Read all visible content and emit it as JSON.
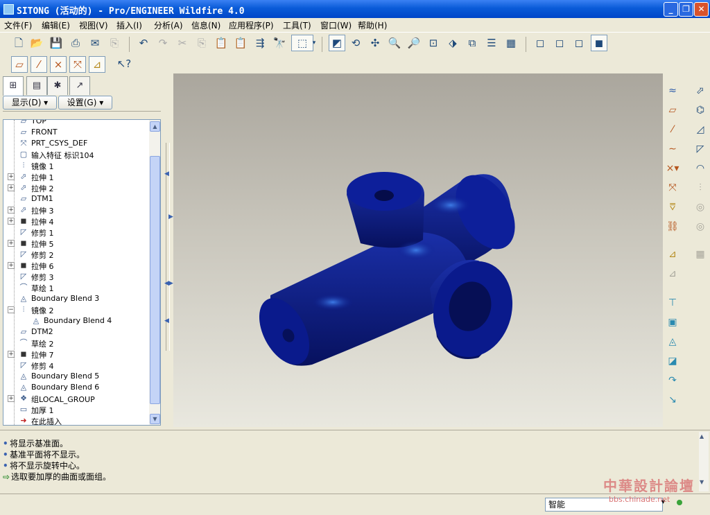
{
  "window": {
    "title": "SITONG (活动的) - Pro/ENGINEER Wildfire 4.0",
    "minimize": "_",
    "maximize": "❐",
    "close": "✕"
  },
  "menu": [
    "文件(F)",
    "编辑(E)",
    "视图(V)",
    "插入(I)",
    "分析(A)",
    "信息(N)",
    "应用程序(P)",
    "工具(T)",
    "窗口(W)",
    "帮助(H)"
  ],
  "toolbar_icons": [
    "new-icon",
    "open-icon",
    "save-icon",
    "print-icon",
    "send-icon",
    "copy-icon",
    "undo-icon",
    "redo-icon",
    "cut-icon",
    "copy-icon",
    "paste-icon",
    "paste-special-icon",
    "regenerate-icon",
    "find-icon",
    "select-box-icon",
    "repaint-icon",
    "spin-center-icon",
    "orient-icon",
    "zoom-in-icon",
    "zoom-out-icon",
    "refit-icon",
    "reorient-icon",
    "saved-views-icon",
    "layers-icon",
    "view-manager-icon",
    "wireframe-icon",
    "hidden-line-icon",
    "no-hidden-icon",
    "shading-icon"
  ],
  "datum_toolbar_icons": [
    "datum-plane-icon",
    "datum-axis-icon",
    "datum-point-icon",
    "csys-icon",
    "annotation-icon",
    "whats-this-icon"
  ],
  "panel": {
    "tabs": [
      "model-tree-tab",
      "folder-tab",
      "favorites-tab",
      "navigator-tab"
    ],
    "show_button": "显示(D) ▾",
    "settings_button": "设置(G) ▾"
  },
  "tree": [
    {
      "label": "TOP",
      "icon": "datum-plane-icon",
      "indent": 1,
      "expand": ""
    },
    {
      "label": "FRONT",
      "icon": "datum-plane-icon",
      "indent": 1,
      "expand": ""
    },
    {
      "label": "PRT_CSYS_DEF",
      "icon": "csys-icon",
      "indent": 1,
      "expand": ""
    },
    {
      "label": "输入特征 标识104",
      "icon": "import-feature-icon",
      "indent": 1,
      "expand": ""
    },
    {
      "label": "镜像 1",
      "icon": "mirror-icon",
      "indent": 1,
      "expand": ""
    },
    {
      "label": "拉伸 1",
      "icon": "extrude-icon",
      "indent": 1,
      "expand": "+"
    },
    {
      "label": "拉伸 2",
      "icon": "extrude-icon",
      "indent": 1,
      "expand": "+"
    },
    {
      "label": "DTM1",
      "icon": "datum-plane-icon",
      "indent": 1,
      "expand": ""
    },
    {
      "label": "拉伸 3",
      "icon": "extrude-icon",
      "indent": 1,
      "expand": "+"
    },
    {
      "label": "拉伸 4",
      "icon": "extrude-solid-icon",
      "indent": 1,
      "expand": "+"
    },
    {
      "label": "修剪 1",
      "icon": "trim-icon",
      "indent": 1,
      "expand": ""
    },
    {
      "label": "拉伸 5",
      "icon": "extrude-solid-icon",
      "indent": 1,
      "expand": "+"
    },
    {
      "label": "修剪 2",
      "icon": "trim-icon",
      "indent": 1,
      "expand": ""
    },
    {
      "label": "拉伸 6",
      "icon": "extrude-solid-icon",
      "indent": 1,
      "expand": "+"
    },
    {
      "label": "修剪 3",
      "icon": "trim-icon",
      "indent": 1,
      "expand": ""
    },
    {
      "label": "草绘 1",
      "icon": "sketch-icon",
      "indent": 1,
      "expand": ""
    },
    {
      "label": "Boundary Blend 3",
      "icon": "boundary-blend-icon",
      "indent": 1,
      "expand": ""
    },
    {
      "label": "镜像 2",
      "icon": "mirror-icon",
      "indent": 1,
      "expand": "−"
    },
    {
      "label": "Boundary Blend 4",
      "icon": "boundary-blend-icon",
      "indent": 2,
      "expand": ""
    },
    {
      "label": "DTM2",
      "icon": "datum-plane-icon",
      "indent": 1,
      "expand": ""
    },
    {
      "label": "草绘 2",
      "icon": "sketch-icon",
      "indent": 1,
      "expand": ""
    },
    {
      "label": "拉伸 7",
      "icon": "extrude-solid-icon",
      "indent": 1,
      "expand": "+"
    },
    {
      "label": "修剪 4",
      "icon": "trim-icon",
      "indent": 1,
      "expand": ""
    },
    {
      "label": "Boundary Blend 5",
      "icon": "boundary-blend-icon",
      "indent": 1,
      "expand": ""
    },
    {
      "label": "Boundary Blend 6",
      "icon": "boundary-blend-icon",
      "indent": 1,
      "expand": ""
    },
    {
      "label": "组LOCAL_GROUP",
      "icon": "group-icon",
      "indent": 1,
      "expand": "+"
    },
    {
      "label": "加厚 1",
      "icon": "thicken-icon",
      "indent": 1,
      "expand": ""
    },
    {
      "label": "在此插入",
      "icon": "insert-here-icon",
      "indent": 1,
      "expand": ""
    }
  ],
  "right_toolbar_icons": [
    [
      "sketched-datum-curve-icon",
      "hole-icon"
    ],
    [
      "datum-plane-tool-icon",
      "shell-icon"
    ],
    [
      "datum-axis-tool-icon",
      "rib-icon"
    ],
    [
      "datum-curve-icon",
      "draft-icon"
    ],
    [
      "datum-point-tool-icon",
      "round-icon"
    ],
    [
      "csys-tool-icon",
      "mirror-tool-icon"
    ],
    [
      "analysis-feature-icon",
      "merge-icon"
    ],
    [
      "chain-icon",
      "trim-tool-icon"
    ],
    [
      "extrude-tool-icon",
      "pattern-icon"
    ],
    [
      "revolve-tool-icon",
      ""
    ],
    [
      "variable-section-sweep-icon",
      ""
    ],
    [
      "boundary-blend-tool-icon",
      ""
    ],
    [
      "style-icon",
      ""
    ],
    [
      "thicken-tool-icon",
      ""
    ],
    [
      "solidify-tool-icon",
      ""
    ],
    [
      "offset-icon",
      ""
    ]
  ],
  "messages": [
    {
      "bullet": "•",
      "text": "将显示基准面。"
    },
    {
      "bullet": "•",
      "text": "基准平面将不显示。"
    },
    {
      "bullet": "•",
      "text": "将不显示旋转中心。"
    },
    {
      "bullet": "⇨",
      "text": "选取要加厚的曲面或面组。"
    }
  ],
  "status": {
    "filter_value": "智能",
    "watermark_title": "中華設計論壇",
    "watermark_url": "bbs.chinade.net"
  },
  "colors": {
    "model_blue": "#0a1a8c",
    "highlight_blue": "#2e6bd8",
    "titlebar_blue": "#0a5bd8"
  }
}
